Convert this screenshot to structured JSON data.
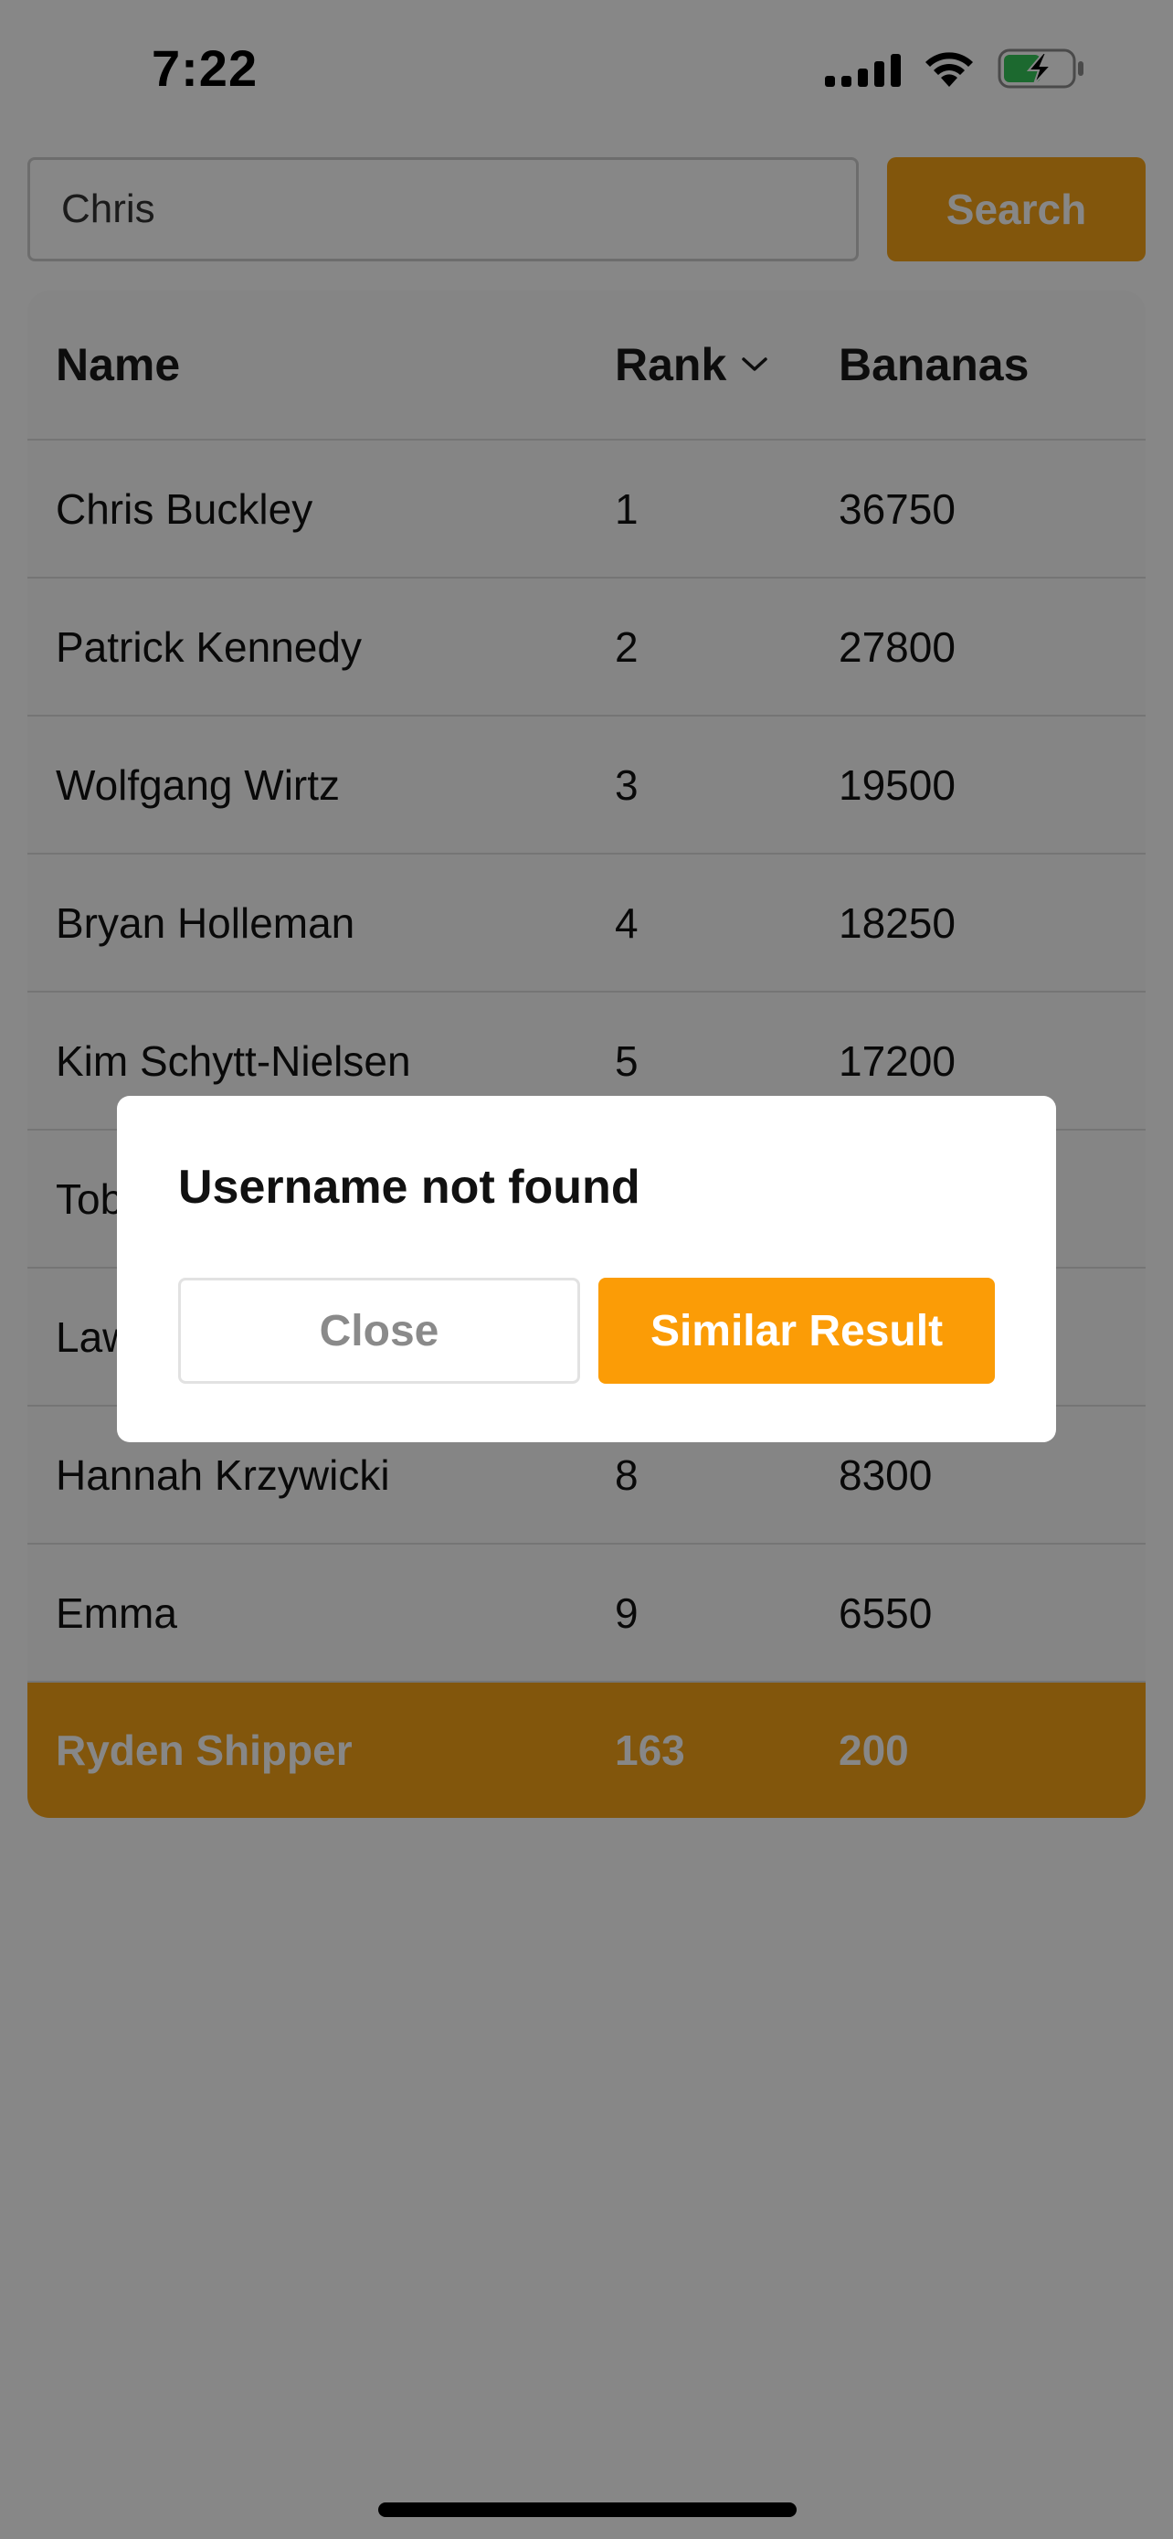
{
  "status_bar": {
    "time": "7:22"
  },
  "search": {
    "value": "Chris",
    "button_label": "Search"
  },
  "table": {
    "columns": {
      "name": "Name",
      "rank": "Rank",
      "bananas": "Bananas"
    },
    "rows": [
      {
        "name": "Chris Buckley",
        "rank": "1",
        "bananas": "36750"
      },
      {
        "name": "Patrick Kennedy",
        "rank": "2",
        "bananas": "27800"
      },
      {
        "name": "Wolfgang Wirtz",
        "rank": "3",
        "bananas": "19500"
      },
      {
        "name": "Bryan Holleman",
        "rank": "4",
        "bananas": "18250"
      },
      {
        "name": "Kim Schytt-Nielsen",
        "rank": "5",
        "bananas": "17200"
      },
      {
        "name": "Tob",
        "rank": "",
        "bananas": ""
      },
      {
        "name": "Law",
        "rank": "",
        "bananas": ""
      },
      {
        "name": "Hannah Krzywicki",
        "rank": "8",
        "bananas": "8300"
      },
      {
        "name": "Emma",
        "rank": "9",
        "bananas": "6550"
      }
    ],
    "current_user": {
      "name": "Ryden Shipper",
      "rank": "163",
      "bananas": "200"
    }
  },
  "dialog": {
    "title": "Username not found",
    "close_label": "Close",
    "similar_label": "Similar Result"
  },
  "colors": {
    "accent": "#f5a317",
    "dialog_button": "#fb9c06",
    "overlay": "rgba(0,0,0,0.47)"
  },
  "icons": [
    "cellular-signal-icon",
    "wifi-icon",
    "battery-charging-icon",
    "chevron-down-icon"
  ]
}
